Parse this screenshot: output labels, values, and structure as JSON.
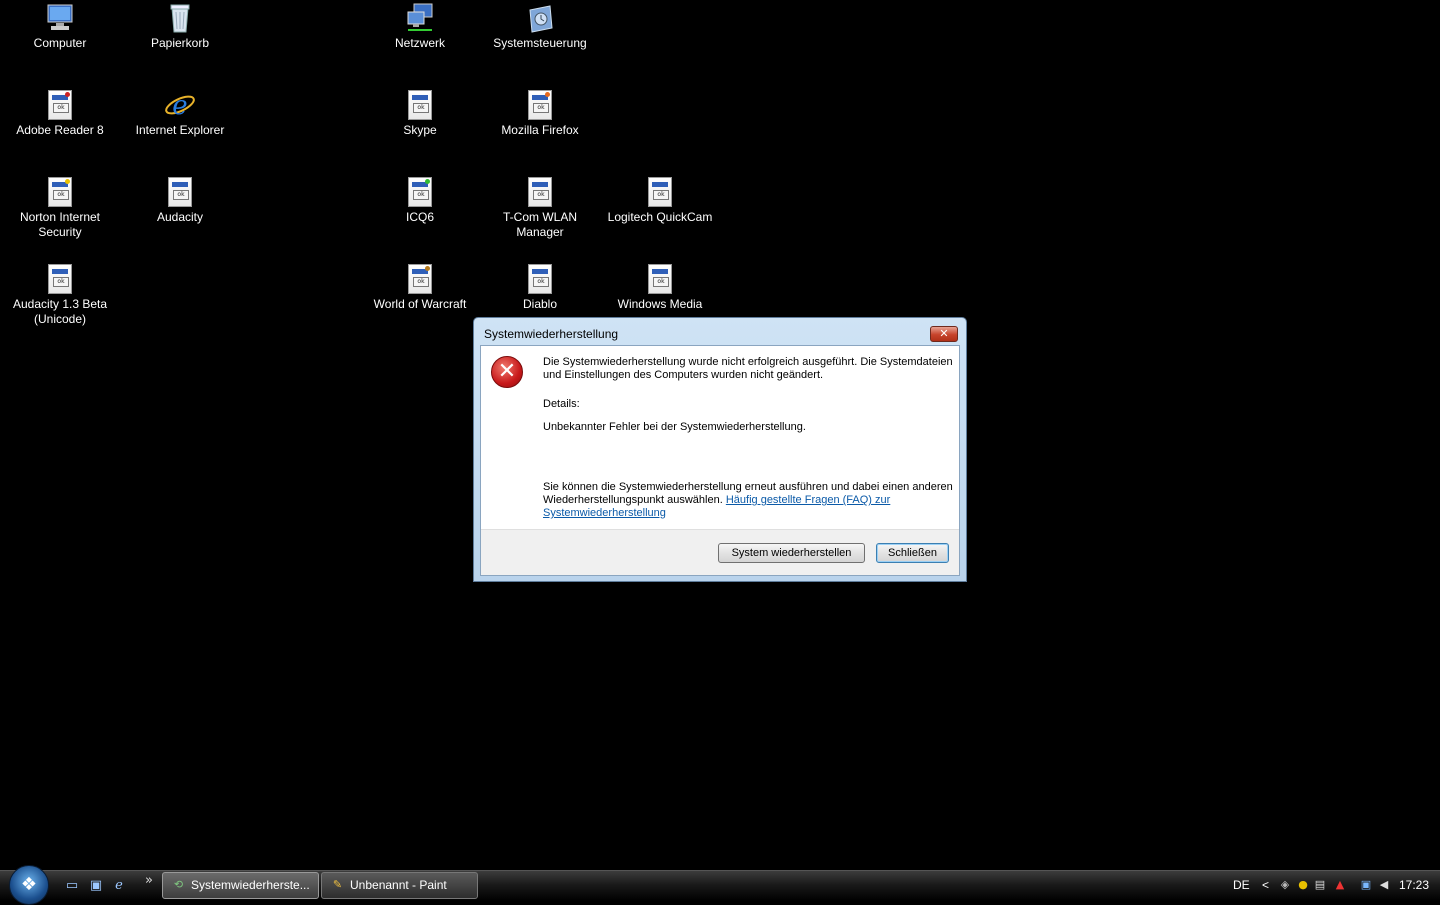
{
  "desktop_icons": [
    {
      "label": "Computer",
      "icon": "computer-icon"
    },
    {
      "label": "Papierkorb",
      "icon": "recycle-bin-icon"
    },
    {
      "label": "Netzwerk",
      "icon": "network-icon"
    },
    {
      "label": "Systemsteuerung",
      "icon": "control-panel-icon"
    },
    {
      "label": "Adobe Reader 8",
      "icon": "app-shortcut-icon"
    },
    {
      "label": "Internet Explorer",
      "icon": "internet-explorer-icon"
    },
    {
      "label": "Skype",
      "icon": "app-shortcut-icon"
    },
    {
      "label": "Mozilla Firefox",
      "icon": "app-shortcut-icon"
    },
    {
      "label": "Norton Internet Security",
      "icon": "app-shortcut-icon"
    },
    {
      "label": "Audacity",
      "icon": "app-shortcut-icon"
    },
    {
      "label": "ICQ6",
      "icon": "app-shortcut-icon"
    },
    {
      "label": "T-Com WLAN Manager",
      "icon": "app-shortcut-icon"
    },
    {
      "label": "Logitech QuickCam",
      "icon": "app-shortcut-icon"
    },
    {
      "label": "Audacity 1.3 Beta (Unicode)",
      "icon": "app-shortcut-icon"
    },
    {
      "label": "World of Warcraft",
      "icon": "app-shortcut-icon"
    },
    {
      "label": "Diablo",
      "icon": "app-shortcut-icon"
    },
    {
      "label": "Windows Media",
      "icon": "app-shortcut-icon"
    }
  ],
  "dialog": {
    "title": "Systemwiederherstellung",
    "close_glyph": "✕",
    "icon": "error-icon",
    "message": "Die Systemwiederherstellung wurde nicht erfolgreich ausgeführt. Die Systemdateien und Einstellungen des Computers wurden nicht geändert.",
    "details_label": "Details:",
    "details_text": "Unbekannter Fehler bei der Systemwiederherstellung.",
    "hint_text": "Sie können die Systemwiederherstellung erneut ausführen und dabei einen anderen Wiederherstellungspunkt auswählen.",
    "faq_link": "Häufig gestellte Fragen (FAQ) zur Systemwiederherstellung",
    "restore_button": "System wiederherstellen",
    "close_button": "Schließen"
  },
  "taskbar": {
    "start_glyph": "❖",
    "quick_launch_more": "»",
    "tasks": [
      {
        "label": "Systemwiederherste...",
        "icon": "system-restore-icon"
      },
      {
        "label": "Unbenannt - Paint",
        "icon": "paint-icon"
      }
    ],
    "language": "DE",
    "tray_expand": "<",
    "clock": "17:23"
  },
  "colors": {
    "desktop": "#000000",
    "dialog_frame": "#b9d3ec",
    "error_red": "#c8191b",
    "link": "#0b5aa8"
  }
}
